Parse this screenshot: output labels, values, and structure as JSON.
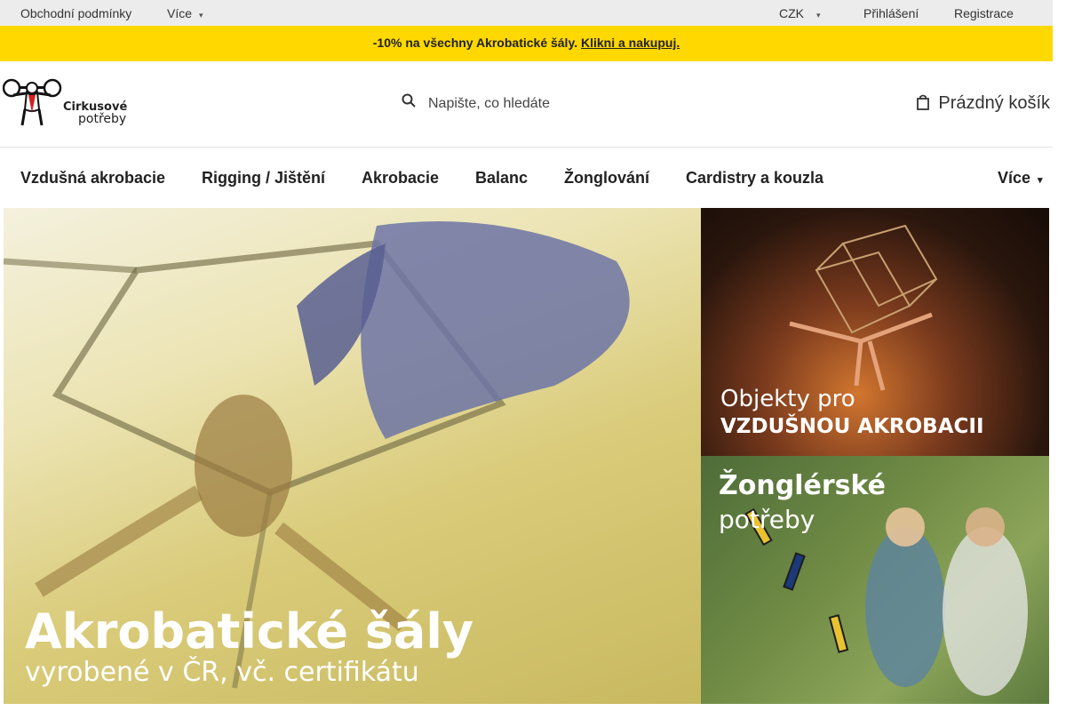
{
  "topbar": {
    "terms": "Obchodní podmínky",
    "more": "Více",
    "currency": "CZK",
    "login": "Přihlášení",
    "register": "Registrace"
  },
  "promo": {
    "icon": "",
    "text": "-10% na všechny Akrobatické šály.",
    "link": "Klikni a nakupuj."
  },
  "header": {
    "logo_line1": "Cirkusové",
    "logo_line2": "potřeby",
    "search_placeholder": "Napište, co hledáte",
    "cart_label": "Prázdný košík"
  },
  "nav": {
    "items": [
      "Vzdušná akrobacie",
      "Rigging / Jištění",
      "Akrobacie",
      "Balanc",
      "Žonglování",
      "Cardistry a kouzla"
    ],
    "more": "Více"
  },
  "banners": {
    "main": {
      "title": "Akrobatické šály",
      "subtitle": "vyrobené v ČR, vč. certifikátu"
    },
    "aerial": {
      "line1": "Objekty pro",
      "line2": "VZDUŠNOU AKROBACII"
    },
    "juggling": {
      "line1": "Žonglérské",
      "line2": "potřeby"
    }
  },
  "colors": {
    "accent": "#ffd800",
    "topbar_bg": "#ececec"
  },
  "icons": {
    "search": "search-icon",
    "cart": "bag-icon",
    "caret": "chevron-down-icon"
  }
}
